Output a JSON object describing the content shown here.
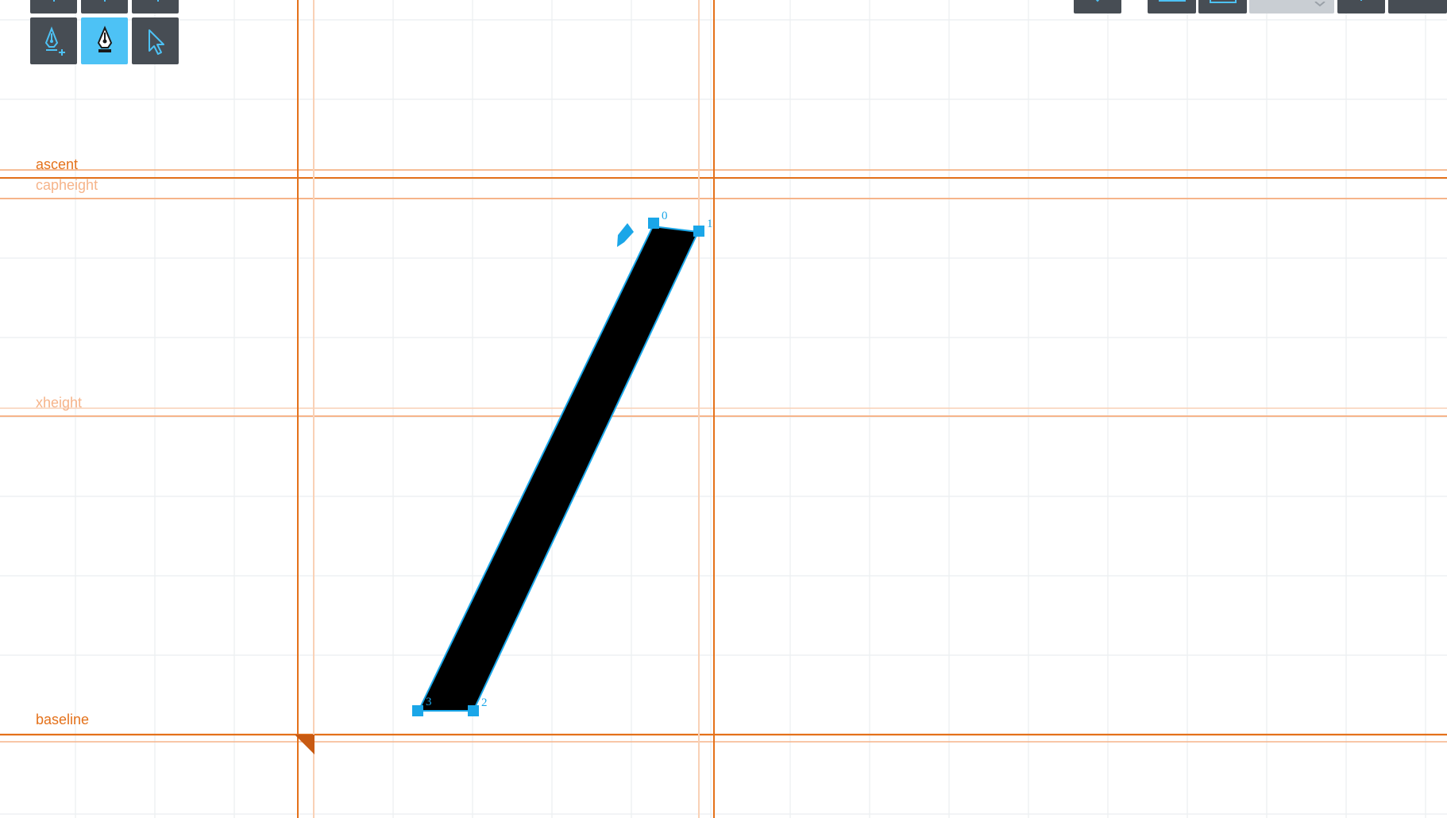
{
  "guides": {
    "ascent": "ascent",
    "capheight": "capheight",
    "xheight": "xheight",
    "baseline": "baseline"
  },
  "points": [
    "0",
    "1",
    "2",
    "3"
  ],
  "toolbar": {
    "left": {
      "row1": [
        "add-point-tool",
        "remove-point-tool",
        "add-path-tool"
      ],
      "row2": [
        "pen-plus-icon",
        "pen-icon",
        "arrow-cursor-icon"
      ],
      "active": "pen-icon"
    },
    "right": [
      "shape-icon",
      "frame-icon",
      "layout-icon",
      "zoom-field",
      "plus-icon",
      "minus-icon"
    ]
  },
  "colors": {
    "guide": "#e4711a",
    "guide_faint": "#f6b48a",
    "grid": "#e9ecef",
    "selection": "#1aa6e8",
    "glyph": "#000000",
    "toolbar": "#474d54",
    "toolbar_active": "#4dc2f5"
  }
}
